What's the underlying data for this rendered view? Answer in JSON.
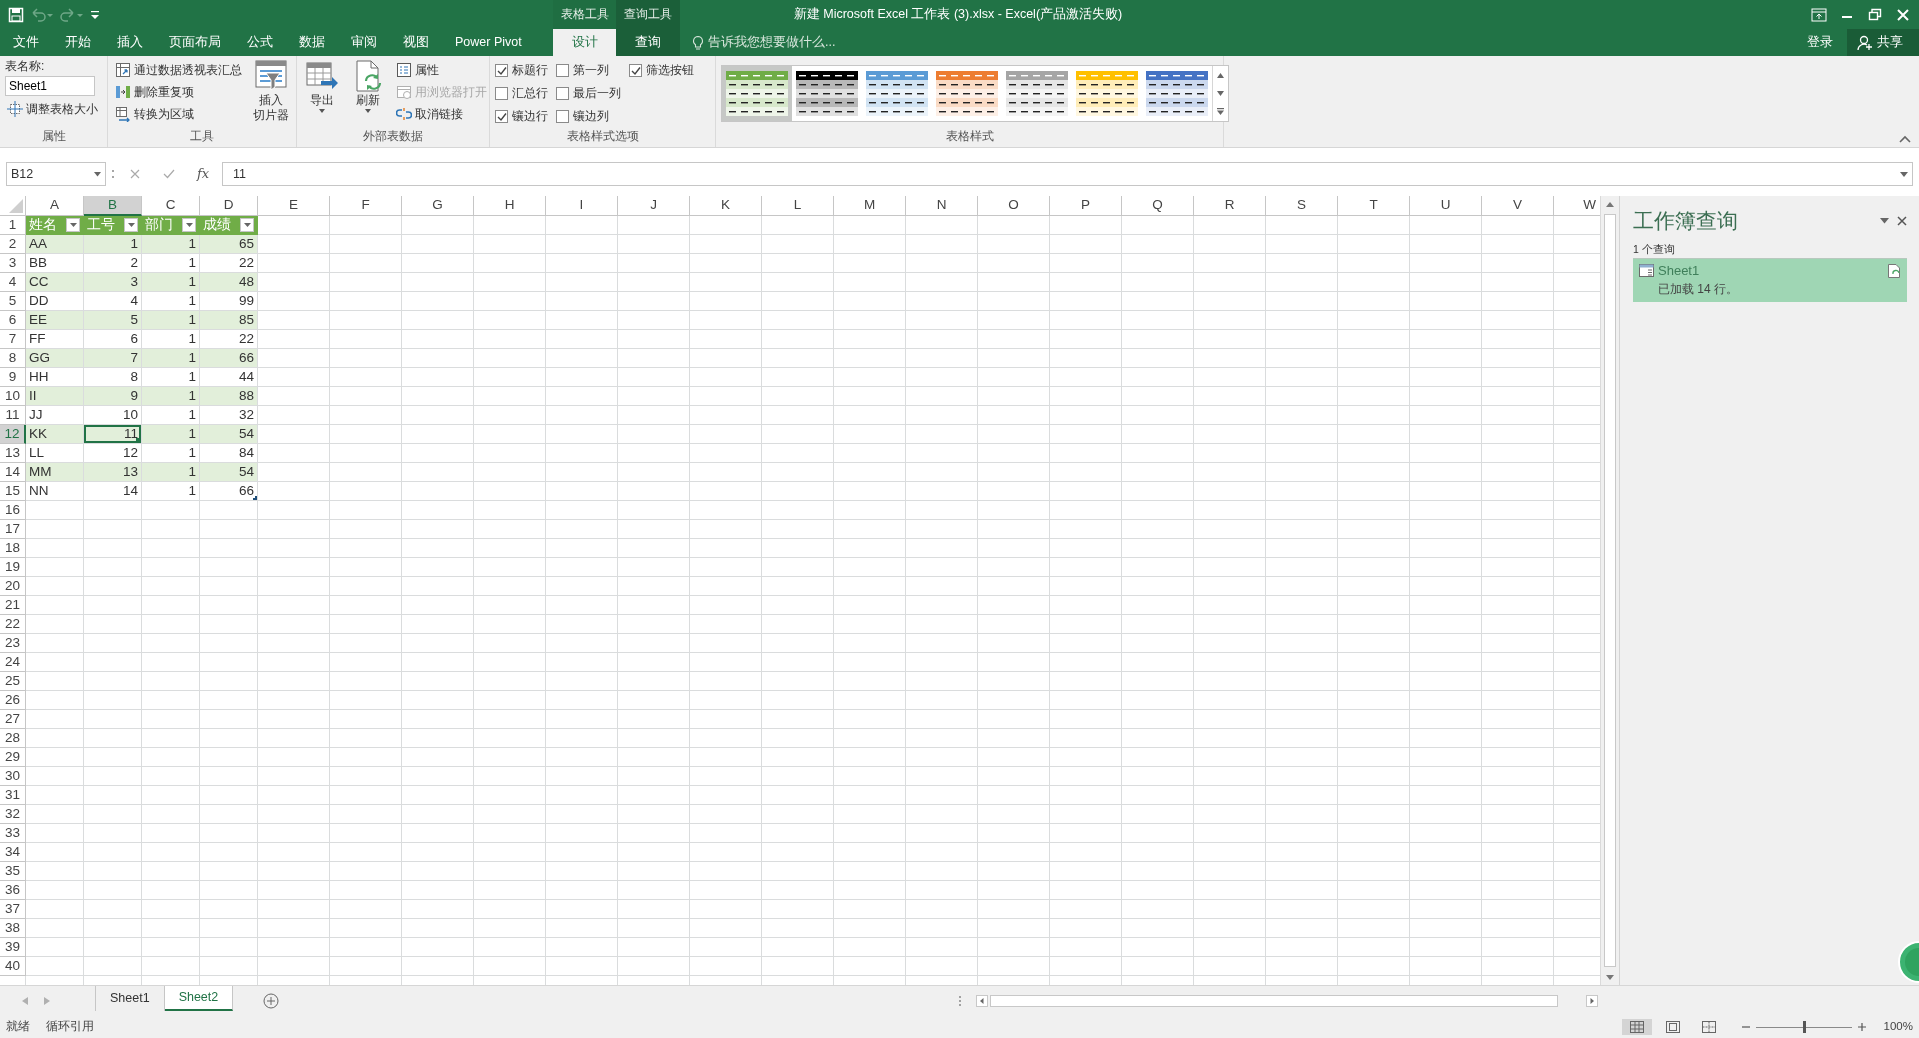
{
  "window": {
    "title": "新建 Microsoft Excel 工作表 (3).xlsx - Excel(产品激活失败)",
    "context_groups": [
      {
        "label": "表格工具"
      },
      {
        "label": "查询工具"
      }
    ]
  },
  "ribbon_tabs": [
    {
      "label": "文件",
      "kind": "main",
      "selected": false
    },
    {
      "label": "开始",
      "kind": "main",
      "selected": false
    },
    {
      "label": "插入",
      "kind": "main",
      "selected": false
    },
    {
      "label": "页面布局",
      "kind": "main",
      "selected": false
    },
    {
      "label": "公式",
      "kind": "main",
      "selected": false
    },
    {
      "label": "数据",
      "kind": "main",
      "selected": false
    },
    {
      "label": "审阅",
      "kind": "main",
      "selected": false
    },
    {
      "label": "视图",
      "kind": "main",
      "selected": false
    },
    {
      "label": "Power Pivot",
      "kind": "main",
      "selected": false
    },
    {
      "label": "设计",
      "kind": "context",
      "selected": true
    },
    {
      "label": "查询",
      "kind": "context",
      "selected": false
    }
  ],
  "tell_me": {
    "placeholder": "告诉我您想要做什么..."
  },
  "account": {
    "sign_in": "登录",
    "share": "共享"
  },
  "ribbon": {
    "groups": [
      {
        "kind": "properties",
        "label": "属性",
        "name_label": "表名称:",
        "name_value": "Sheet1",
        "resize": "调整表格大小"
      },
      {
        "kind": "tools",
        "label": "工具",
        "items": [
          {
            "label": "通过数据透视表汇总"
          },
          {
            "label": "删除重复项"
          },
          {
            "label": "转换为区域"
          }
        ],
        "large": {
          "lines": [
            "插入",
            "切片器"
          ]
        }
      },
      {
        "kind": "external",
        "label": "外部表数据",
        "large": [
          {
            "lines": [
              "导出"
            ]
          },
          {
            "lines": [
              "刷新"
            ]
          }
        ],
        "items": [
          {
            "label": "属性",
            "disabled": false
          },
          {
            "label": "用浏览器打开",
            "disabled": true
          },
          {
            "label": "取消链接",
            "disabled": false
          }
        ]
      },
      {
        "kind": "options",
        "label": "表格样式选项",
        "checkboxes": [
          {
            "label": "标题行",
            "checked": true
          },
          {
            "label": "汇总行",
            "checked": false
          },
          {
            "label": "镶边行",
            "checked": true
          },
          {
            "label": "第一列",
            "checked": false
          },
          {
            "label": "最后一列",
            "checked": false
          },
          {
            "label": "镶边列",
            "checked": false
          },
          {
            "label": "筛选按钮",
            "checked": true
          }
        ]
      },
      {
        "kind": "styles",
        "label": "表格样式",
        "styles": [
          {
            "color": "#70ad47",
            "selected": true
          },
          {
            "color": "#000000",
            "selected": false
          },
          {
            "color": "#5b9bd5",
            "selected": false
          },
          {
            "color": "#ed7d31",
            "selected": false
          },
          {
            "color": "#a5a5a5",
            "selected": false
          },
          {
            "color": "#ffc000",
            "selected": false
          },
          {
            "color": "#4472c4",
            "selected": false
          }
        ]
      }
    ]
  },
  "formula_bar": {
    "name_box": "B12",
    "fx": "fx",
    "value": "11"
  },
  "sheet": {
    "columns": [
      "A",
      "B",
      "C",
      "D",
      "E",
      "F",
      "G",
      "H",
      "I",
      "J",
      "K",
      "L",
      "M",
      "N",
      "O",
      "P",
      "Q",
      "R",
      "S",
      "T",
      "U",
      "V",
      "W"
    ],
    "row_numbers": [
      "1",
      "2",
      "3",
      "4",
      "5",
      "6",
      "7",
      "8",
      "9",
      "10",
      "11",
      "12",
      "13",
      "14",
      "15",
      "16",
      "17",
      "18",
      "19",
      "20",
      "21",
      "22",
      "23",
      "24",
      "25",
      "26",
      "27",
      "28",
      "29",
      "30",
      "31",
      "32",
      "33",
      "34",
      "35",
      "36",
      "37",
      "38",
      "39",
      "40"
    ],
    "table": {
      "headers": [
        "姓名",
        "工号",
        "部门",
        "成绩"
      ],
      "rows": [
        [
          {
            "text": "AA",
            "selected": false
          },
          {
            "text": "1",
            "selected": false
          },
          {
            "text": "1",
            "selected": false
          },
          {
            "text": "65",
            "selected": false
          }
        ],
        [
          {
            "text": "BB",
            "selected": false
          },
          {
            "text": "2",
            "selected": false
          },
          {
            "text": "1",
            "selected": false
          },
          {
            "text": "22",
            "selected": false
          }
        ],
        [
          {
            "text": "CC",
            "selected": false
          },
          {
            "text": "3",
            "selected": false
          },
          {
            "text": "1",
            "selected": false
          },
          {
            "text": "48",
            "selected": false
          }
        ],
        [
          {
            "text": "DD",
            "selected": false
          },
          {
            "text": "4",
            "selected": false
          },
          {
            "text": "1",
            "selected": false
          },
          {
            "text": "99",
            "selected": false
          }
        ],
        [
          {
            "text": "EE",
            "selected": false
          },
          {
            "text": "5",
            "selected": false
          },
          {
            "text": "1",
            "selected": false
          },
          {
            "text": "85",
            "selected": false
          }
        ],
        [
          {
            "text": "FF",
            "selected": false
          },
          {
            "text": "6",
            "selected": false
          },
          {
            "text": "1",
            "selected": false
          },
          {
            "text": "22",
            "selected": false
          }
        ],
        [
          {
            "text": "GG",
            "selected": false
          },
          {
            "text": "7",
            "selected": false
          },
          {
            "text": "1",
            "selected": false
          },
          {
            "text": "66",
            "selected": false
          }
        ],
        [
          {
            "text": "HH",
            "selected": false
          },
          {
            "text": "8",
            "selected": false
          },
          {
            "text": "1",
            "selected": false
          },
          {
            "text": "44",
            "selected": false
          }
        ],
        [
          {
            "text": "II",
            "selected": false
          },
          {
            "text": "9",
            "selected": false
          },
          {
            "text": "1",
            "selected": false
          },
          {
            "text": "88",
            "selected": false
          }
        ],
        [
          {
            "text": "JJ",
            "selected": false
          },
          {
            "text": "10",
            "selected": false
          },
          {
            "text": "1",
            "selected": false
          },
          {
            "text": "32",
            "selected": false
          }
        ],
        [
          {
            "text": "KK",
            "selected": false
          },
          {
            "text": "11",
            "selected": true
          },
          {
            "text": "1",
            "selected": false
          },
          {
            "text": "54",
            "selected": false
          }
        ],
        [
          {
            "text": "LL",
            "selected": false
          },
          {
            "text": "12",
            "selected": false
          },
          {
            "text": "1",
            "selected": false
          },
          {
            "text": "84",
            "selected": false
          }
        ],
        [
          {
            "text": "MM",
            "selected": false
          },
          {
            "text": "13",
            "selected": false
          },
          {
            "text": "1",
            "selected": false
          },
          {
            "text": "54",
            "selected": false
          }
        ],
        [
          {
            "text": "NN",
            "selected": false
          },
          {
            "text": "14",
            "selected": false
          },
          {
            "text": "1",
            "selected": false
          },
          {
            "text": "66",
            "selected": false
          }
        ]
      ]
    }
  },
  "sheet_tabs": [
    {
      "label": "Sheet1",
      "selected": false
    },
    {
      "label": "Sheet2",
      "selected": true
    }
  ],
  "query_pane": {
    "title": "工作簿查询",
    "count": "1 个查询",
    "queries": [
      {
        "name": "Sheet1",
        "status": "已加载 14 行。",
        "selected": true
      }
    ]
  },
  "status_bar": {
    "left": [
      "就绪",
      "循环引用"
    ],
    "views": [
      {
        "selected": true
      },
      {
        "selected": false
      },
      {
        "selected": false
      }
    ],
    "zoom": {
      "level": 0.5,
      "label": "100%"
    }
  }
}
